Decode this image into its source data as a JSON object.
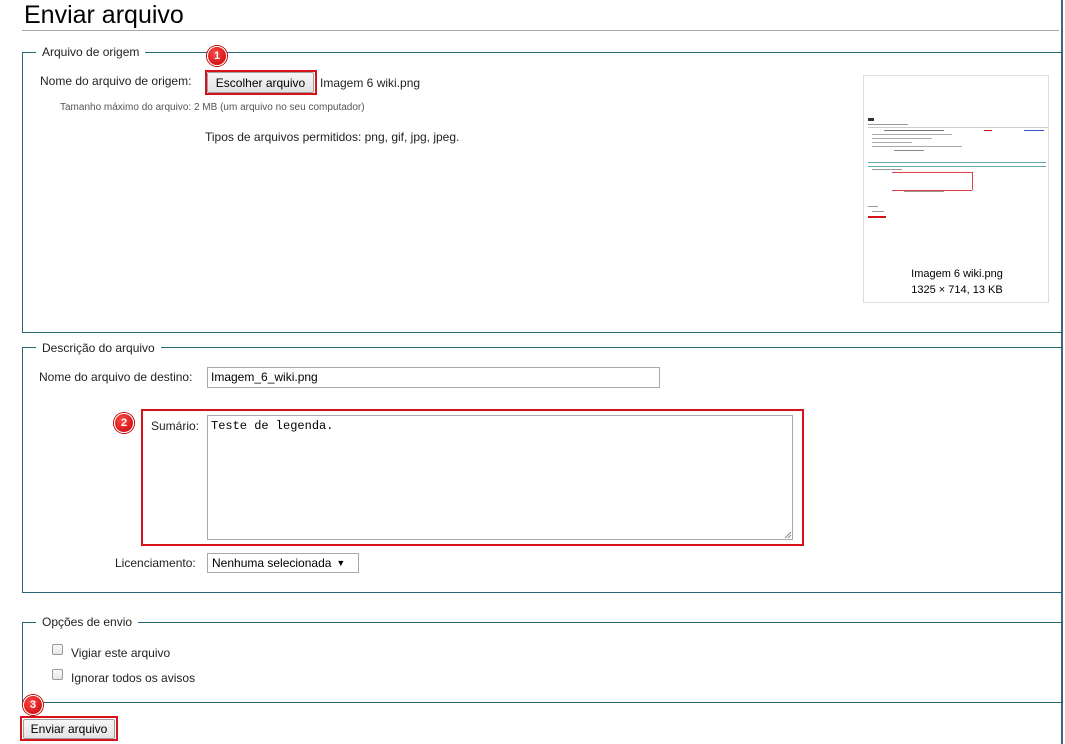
{
  "page": {
    "title": "Enviar arquivo"
  },
  "source": {
    "legend": "Arquivo de origem",
    "file_label": "Nome do arquivo de origem:",
    "choose_button": "Escolher arquivo",
    "chosen_file": "Imagem 6 wiki.png",
    "max_size_note": "Tamanho máximo do arquivo: 2 MB (um arquivo no seu computador)",
    "allowed_types": "Tipos de arquivos permitidos: png, gif, jpg, jpeg.",
    "preview": {
      "name": "Imagem 6 wiki.png",
      "meta": "1325 × 714, 13 KB"
    }
  },
  "description": {
    "legend": "Descrição do arquivo",
    "dest_label": "Nome do arquivo de destino:",
    "dest_value": "Imagem_6_wiki.png",
    "summary_label": "Sumário:",
    "summary_value": "Teste de legenda.",
    "license_label": "Licenciamento:",
    "license_value": "Nenhuma selecionada"
  },
  "options": {
    "legend": "Opções de envio",
    "watch_label": "Vigiar este arquivo",
    "ignore_label": "Ignorar todos os avisos"
  },
  "submit_label": "Enviar arquivo",
  "badges": [
    "1",
    "2",
    "3"
  ],
  "colors": {
    "highlight": "#d6121b",
    "fieldset_border": "#2a6576"
  }
}
